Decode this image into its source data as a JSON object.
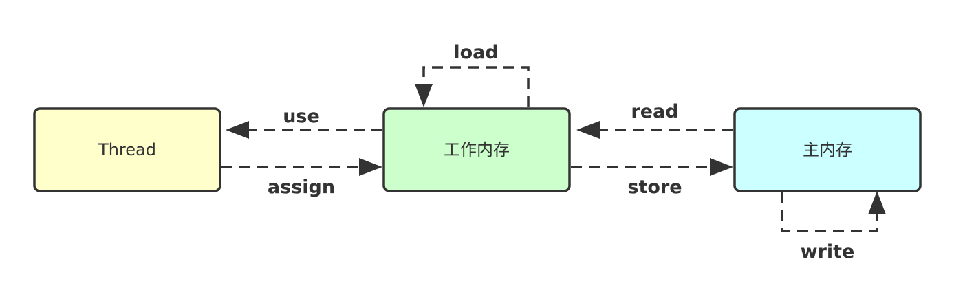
{
  "nodes": {
    "thread": {
      "label": "Thread",
      "fill": "#ffffcc"
    },
    "working_memory": {
      "label": "工作内存",
      "fill": "#ccffcc"
    },
    "main_memory": {
      "label": "主内存",
      "fill": "#ccffff"
    }
  },
  "edges": {
    "use": {
      "label": "use",
      "from": "working_memory",
      "to": "thread"
    },
    "assign": {
      "label": "assign",
      "from": "thread",
      "to": "working_memory"
    },
    "load": {
      "label": "load",
      "from": "working_memory",
      "to": "working_memory"
    },
    "read": {
      "label": "read",
      "from": "main_memory",
      "to": "working_memory"
    },
    "store": {
      "label": "store",
      "from": "working_memory",
      "to": "main_memory"
    },
    "write": {
      "label": "write",
      "from": "main_memory",
      "to": "main_memory"
    }
  },
  "colors": {
    "stroke": "#333333",
    "text": "#333333",
    "background": "#ffffff"
  }
}
